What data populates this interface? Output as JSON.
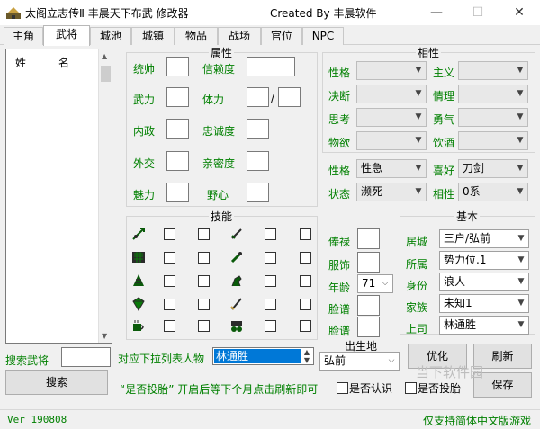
{
  "window": {
    "title": "太阁立志传Ⅱ 丰晨天下布武 修改器",
    "created_by": "Created By 丰晨软件",
    "min_label": "—",
    "max_label": "☐",
    "close_label": "✕"
  },
  "tabs": [
    "主角",
    "武将",
    "城池",
    "城镇",
    "物品",
    "战场",
    "官位",
    "NPC"
  ],
  "list": {
    "col_surname": "姓",
    "col_name": "名"
  },
  "attributes": {
    "title": "属性",
    "labels": [
      "统帅",
      "信赖度",
      "武力",
      "体力",
      "内政",
      "忠诚度",
      "外交",
      "亲密度",
      "魅力",
      "野心"
    ],
    "slash": "/"
  },
  "affinity": {
    "title": "相性",
    "left_labels": [
      "性格",
      "决断",
      "思考",
      "物欲"
    ],
    "right_labels": [
      "主义",
      "情理",
      "勇气",
      "饮酒"
    ]
  },
  "traits": {
    "personality_label": "性格",
    "personality_value": "性急",
    "hobby_label": "喜好",
    "hobby_value": "刀剑",
    "state_label": "状态",
    "state_value": "濒死",
    "affinity_label": "相性",
    "affinity_value": "0系"
  },
  "skills": {
    "title": "技能"
  },
  "misc": {
    "labels": [
      "俸禄",
      "服饰",
      "年龄",
      "脸谱",
      "脸谱"
    ],
    "age_value": "71"
  },
  "basic": {
    "title": "基本",
    "labels": [
      "居城",
      "所属",
      "身份",
      "家族",
      "上司"
    ],
    "values": [
      "三户/弘前",
      "势力位.1",
      "浪人",
      "未知1",
      "林通胜"
    ]
  },
  "search": {
    "label": "搜索武将",
    "button": "搜索",
    "dropdown_label": "对应下拉列表人物",
    "dropdown_value": "林通胜"
  },
  "birthplace": {
    "label": "出生地",
    "value": "弘前"
  },
  "buttons": {
    "optimize": "优化",
    "refresh": "刷新",
    "save": "保存"
  },
  "hint": "“是否投胎” 开启后等下个月点击刷新即可",
  "checks": {
    "recognized": "是否认识",
    "reborn": "是否投胎"
  },
  "status": {
    "version": "Ver 190808",
    "note": "仅支持简体中文版游戏"
  },
  "watermark": "当下软件园"
}
